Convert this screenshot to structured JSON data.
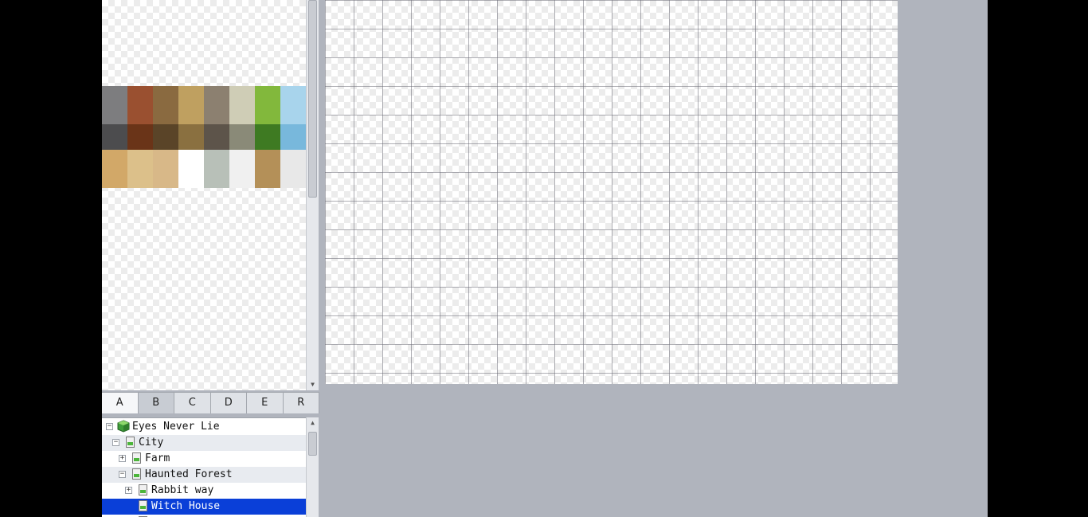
{
  "tileset_tabs": [
    "A",
    "B",
    "C",
    "D",
    "E",
    "R"
  ],
  "active_tab": "A",
  "tile_colors": {
    "row1": [
      "#7d7d7f",
      "#9a5030",
      "#8a6a40",
      "#bfa060",
      "#8c8070",
      "#cfcdb6",
      "#82b83c",
      "#a8d4ec"
    ],
    "row2": [
      "#4c4c4e",
      "#6a3418",
      "#5a4428",
      "#8a7040",
      "#5d544a",
      "#8a8a78",
      "#3e7a22",
      "#78b8dc"
    ],
    "row3": [
      "#d2a868",
      "#dcc08a",
      "#d8b888",
      "#ffffff",
      "#b8c0b8",
      "#f0f0f0",
      "#b49058",
      "#e8e8e8"
    ]
  },
  "tree": {
    "items": [
      {
        "label": "Eyes Never Lie",
        "expander": "−",
        "icon": "project"
      },
      {
        "label": "City",
        "expander": "−",
        "icon": "map"
      },
      {
        "label": "Farm",
        "expander": "+",
        "icon": "map"
      },
      {
        "label": "Haunted Forest",
        "expander": "−",
        "icon": "map"
      },
      {
        "label": "Rabbit way",
        "expander": "+",
        "icon": "map"
      },
      {
        "label": "Witch House",
        "expander": "",
        "icon": "map",
        "selected": true
      }
    ]
  },
  "colors": {
    "background": "#b0b4bd",
    "selection": "#0a3fd8",
    "grid_line": "#6e6e78"
  }
}
